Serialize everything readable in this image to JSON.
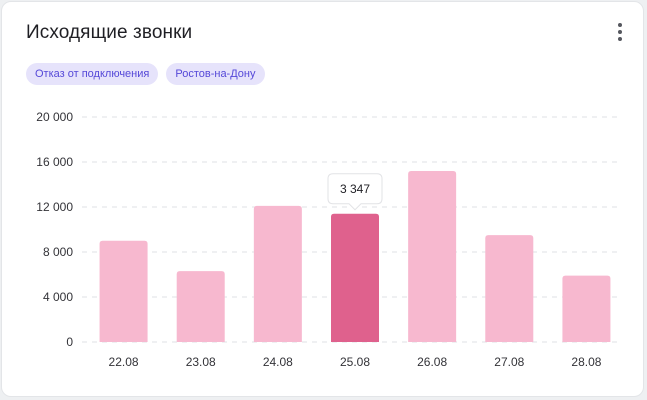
{
  "card": {
    "title": "Исходящие звонки",
    "menu_icon": "more-vertical-icon"
  },
  "filters": [
    {
      "label": "Отказ от подключения"
    },
    {
      "label": "Ростов-на-Дону"
    }
  ],
  "colors": {
    "bar": "#f7b8cf",
    "bar_active": "#df618d",
    "chip_bg": "#e6e3fb",
    "chip_text": "#5548d8",
    "grid": "#dfe1e5"
  },
  "chart_data": {
    "type": "bar",
    "categories": [
      "22.08",
      "23.08",
      "24.08",
      "25.08",
      "26.08",
      "27.08",
      "28.08"
    ],
    "values": [
      9000,
      6300,
      12100,
      11400,
      15200,
      9500,
      5900
    ],
    "ylim": [
      0,
      20000
    ],
    "yticks": [
      "0",
      "4 000",
      "8 000",
      "12 000",
      "16 000",
      "20 000"
    ],
    "ytick_values": [
      0,
      4000,
      8000,
      12000,
      16000,
      20000
    ],
    "grid": true,
    "highlighted_index": 3,
    "tooltip": {
      "label": "3 347"
    }
  }
}
